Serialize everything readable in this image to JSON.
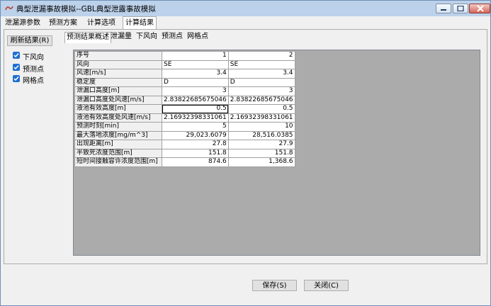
{
  "window": {
    "title": "典型泄漏事故模拟--GBL典型泄露事故模拟"
  },
  "main_tabs": [
    {
      "label": "泄漏源参数"
    },
    {
      "label": "预测方案"
    },
    {
      "label": "计算选项"
    },
    {
      "label": "计算结果"
    }
  ],
  "sidebar": {
    "refresh_label": "刷新结果(R)",
    "checkboxes": [
      {
        "label": "下风向",
        "checked": true
      },
      {
        "label": "预测点",
        "checked": true
      },
      {
        "label": "网格点",
        "checked": true
      }
    ]
  },
  "sub_tabs": [
    {
      "label": "预测结果概述"
    },
    {
      "label": "泄漏量"
    },
    {
      "label": "下风向"
    },
    {
      "label": "预测点"
    },
    {
      "label": "网格点"
    }
  ],
  "grid": {
    "rows": [
      {
        "label": "序号",
        "v1": "1",
        "v2": "2"
      },
      {
        "label": "风向",
        "v1": "SE",
        "v2": "SE"
      },
      {
        "label": "风速[m/s]",
        "v1": "3.4",
        "v2": "3.4"
      },
      {
        "label": "稳定度",
        "v1": "D",
        "v2": "D"
      },
      {
        "label": "泄漏口高度[m]",
        "v1": "3",
        "v2": "3"
      },
      {
        "label": "泄漏口高度处风速[m/s]",
        "v1": "2.83822685675046",
        "v2": "2.83822685675046"
      },
      {
        "label": "液池有效高度[m]",
        "v1": "0.5",
        "v2": "0.5"
      },
      {
        "label": "液池有效高度处风速[m/s]",
        "v1": "2.16932398331061",
        "v2": "2.16932398331061"
      },
      {
        "label": "预测时刻[min]",
        "v1": "5",
        "v2": "10"
      },
      {
        "label": "最大落地浓度[mg/m^3]",
        "v1": "29,023.6079",
        "v2": "28,516.0385"
      },
      {
        "label": "出现距离[m]",
        "v1": "27.8",
        "v2": "27.9"
      },
      {
        "label": "半致死浓度范围[m]",
        "v1": "151.8",
        "v2": "151.8"
      },
      {
        "label": "短时间接触容许浓度范围[m]",
        "v1": "874.6",
        "v2": "1,368.6"
      }
    ]
  },
  "buttons": {
    "save_label": "保存(S)",
    "close_label": "关闭(C)"
  }
}
